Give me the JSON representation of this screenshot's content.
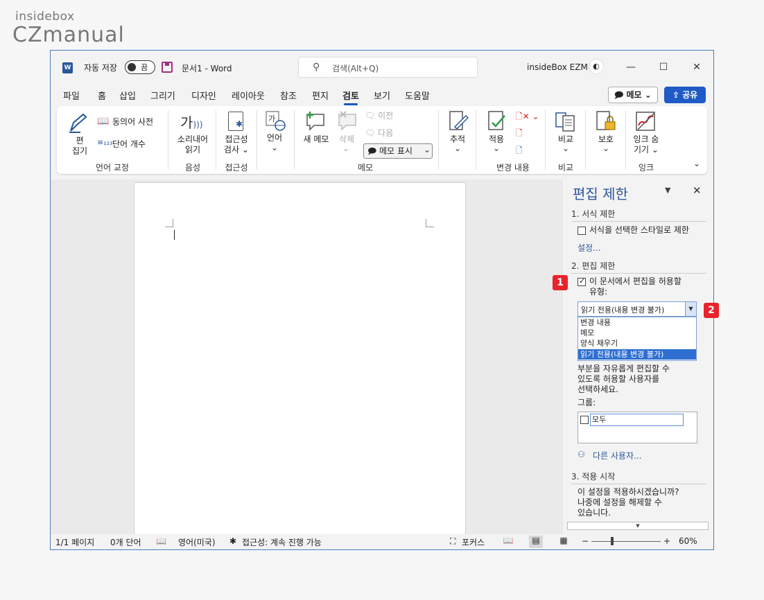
{
  "watermark": {
    "line1": "insidebox",
    "line2": "CZmanual"
  },
  "titlebar": {
    "logo": "W",
    "autosave_label": "자동 저장",
    "autosave_toggle": "끔",
    "doc_title": "문서1  -  Word",
    "search_placeholder": "검색(Alt+Q)",
    "user_name": "insideBox EZM",
    "minimize": "—",
    "maximize": "☐",
    "close": "✕"
  },
  "tabs": [
    "파일",
    "홈",
    "삽입",
    "그리기",
    "디자인",
    "레이아웃",
    "참조",
    "편지",
    "검토",
    "보기",
    "도움말"
  ],
  "active_tab": "검토",
  "memo_button": "메모 ⌄",
  "share_button": "공유",
  "ribbon": {
    "edit_line1": "편",
    "edit_line2": "집기",
    "thesaurus": "동의어 사전",
    "word_count": "단어 개수",
    "group_proofing": "언어 교정",
    "read_aloud_1": "소리내어",
    "read_aloud_2": "읽기",
    "group_speech": "음성",
    "accessibility_1": "접근성",
    "accessibility_2": "검사 ⌄",
    "group_accessibility": "접근성",
    "language": "언어",
    "new_comment": "새 메모",
    "delete": "삭제",
    "previous": "이전",
    "next": "다음",
    "show_comments": "메모 표시",
    "group_comments": "메모",
    "tracking": "추적",
    "accept": "적용",
    "group_changes": "변경 내용",
    "compare": "비교",
    "group_compare": "비교",
    "protect": "보호",
    "hide_ink_1": "잉크 숨",
    "hide_ink_2": "기기 ⌄",
    "group_ink": "잉크"
  },
  "pane": {
    "title": "편집 제한",
    "section1": "1. 서식 제한",
    "format_restrict": "서식을 선택한 스타일로 제한",
    "settings_link": "설정...",
    "section2": "2. 편집 제한",
    "allow_edit_line1": "이 문서에서 편집을 허용할",
    "allow_edit_line2": "유형:",
    "allow_edit_checked": true,
    "select_value": "읽기 전용(내용 변경 불가)",
    "options": [
      "변경 내용",
      "메모",
      "양식 채우기",
      "읽기 전용(내용 변경 불가)"
    ],
    "selected_option": "읽기 전용(내용 변경 불가)",
    "exceptions_line1": "부분을 자유롭게 편집할 수",
    "exceptions_line2": "있도록 허용할 사용자를",
    "exceptions_line3": "선택하세요.",
    "groups_label": "그룹:",
    "group_everyone": "모두",
    "more_users": "다른 사용자...",
    "section3": "3. 적용 시작",
    "apply_line1": "이 설정을 적용하시겠습니까?",
    "apply_line2": "나중에 설정을 해제할 수",
    "apply_line3": "있습니다."
  },
  "badges": {
    "one": "1",
    "two": "2"
  },
  "statusbar": {
    "page": "1/1 페이지",
    "words": "0개 단어",
    "language": "영어(미국)",
    "accessibility": "접근성: 계속 진행 가능",
    "focus": "포커스",
    "zoom_minus": "−",
    "zoom_plus": "+",
    "zoom_level": "60%"
  }
}
